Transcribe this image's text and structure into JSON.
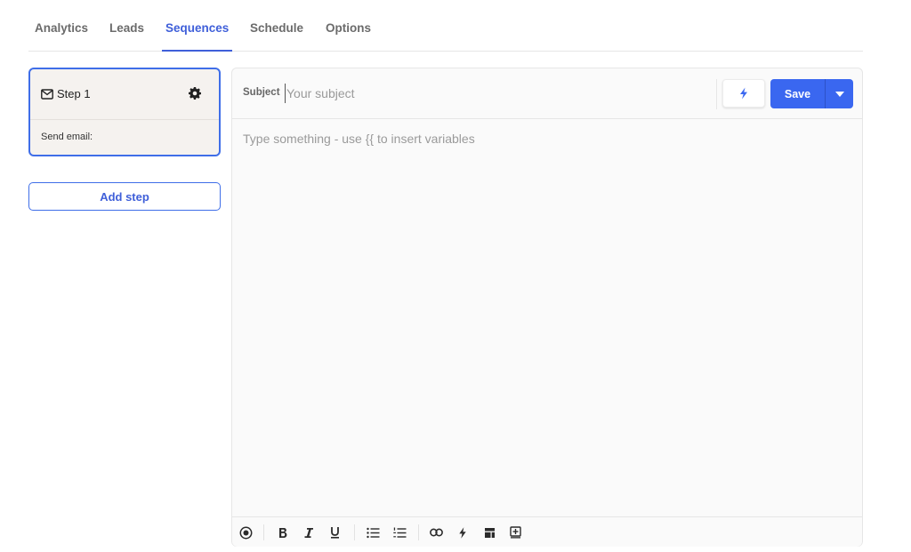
{
  "tabs": [
    {
      "label": "Analytics",
      "active": false
    },
    {
      "label": "Leads",
      "active": false
    },
    {
      "label": "Sequences",
      "active": true
    },
    {
      "label": "Schedule",
      "active": false
    },
    {
      "label": "Options",
      "active": false
    }
  ],
  "sidebar": {
    "step": {
      "label": "Step 1",
      "icon": "mail-icon",
      "settings_icon": "gear-icon",
      "description": "Send email:"
    },
    "add_step_label": "Add step"
  },
  "editor": {
    "subject_label": "Subject",
    "subject_placeholder": "Your subject",
    "subject_value": "",
    "variables_icon": "bolt-icon",
    "save_label": "Save",
    "save_menu_icon": "caret-down-icon",
    "body_placeholder": "Type something - use {{ to insert variables",
    "toolbar": [
      "ai-icon",
      "bold-icon",
      "italic-icon",
      "underline-icon",
      "bulleted-list-icon",
      "numbered-list-icon",
      "link-icon",
      "bolt-icon",
      "template-icon",
      "add-block-icon"
    ]
  },
  "colors": {
    "accent": "#3f5fd9",
    "save_button": "#3a67f0",
    "step_card_bg": "#f5f2ef"
  }
}
